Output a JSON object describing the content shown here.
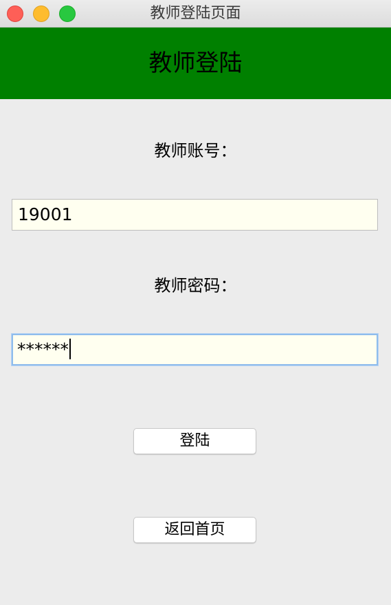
{
  "window": {
    "title": "教师登陆页面",
    "controls": [
      "close-icon",
      "minimize-icon",
      "zoom-icon"
    ],
    "control_colors": {
      "close": "#fe5f57",
      "minimize": "#febc2e",
      "zoom": "#28c840"
    }
  },
  "banner": {
    "title": "教师登陆",
    "background": "#008000"
  },
  "form": {
    "account_label": "教师账号：",
    "account_value": "19001",
    "password_label": "教师密码：",
    "password_value": "******",
    "field_background": "#fffff0"
  },
  "buttons": {
    "login_label": "登陆",
    "home_label": "返回首页"
  }
}
